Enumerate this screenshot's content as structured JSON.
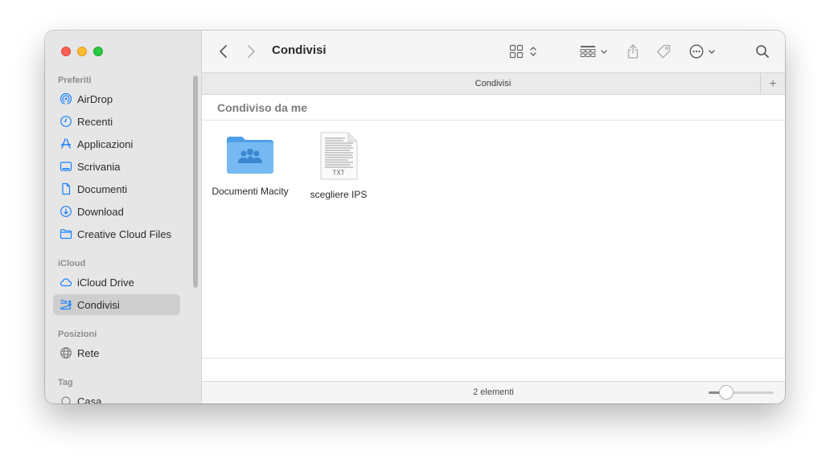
{
  "window": {
    "title": "Condivisi"
  },
  "sidebar": {
    "sections": [
      {
        "label": "Preferiti"
      },
      {
        "label": "iCloud"
      },
      {
        "label": "Posizioni"
      },
      {
        "label": "Tag"
      }
    ],
    "favorites": [
      {
        "label": "AirDrop",
        "icon": "airdrop-icon"
      },
      {
        "label": "Recenti",
        "icon": "clock-icon"
      },
      {
        "label": "Applicazioni",
        "icon": "applications-icon"
      },
      {
        "label": "Scrivania",
        "icon": "desktop-icon"
      },
      {
        "label": "Documenti",
        "icon": "document-icon"
      },
      {
        "label": "Download",
        "icon": "download-icon"
      },
      {
        "label": "Creative Cloud Files",
        "icon": "folder-icon"
      }
    ],
    "icloud": [
      {
        "label": "iCloud Drive",
        "icon": "cloud-icon"
      },
      {
        "label": "Condivisi",
        "icon": "shared-folder-icon",
        "selected": true
      }
    ],
    "locations": [
      {
        "label": "Rete",
        "icon": "globe-icon"
      }
    ],
    "tags": [
      {
        "label": "Casa",
        "icon": "tag-circle-icon"
      }
    ]
  },
  "toolbar": {
    "title": "Condivisi",
    "accent": "#1a82fb"
  },
  "tabbar": {
    "label": "Condivisi",
    "add": "+"
  },
  "content": {
    "group_header": "Condiviso da me",
    "files": [
      {
        "name": "Documenti Macity",
        "icon": "shared-folder-icon"
      },
      {
        "name": "scegliere IPS",
        "icon": "txt-file-icon",
        "badge": "TXT"
      }
    ]
  },
  "statusbar": {
    "count": "2 elementi",
    "zoom_level": 0.27
  }
}
